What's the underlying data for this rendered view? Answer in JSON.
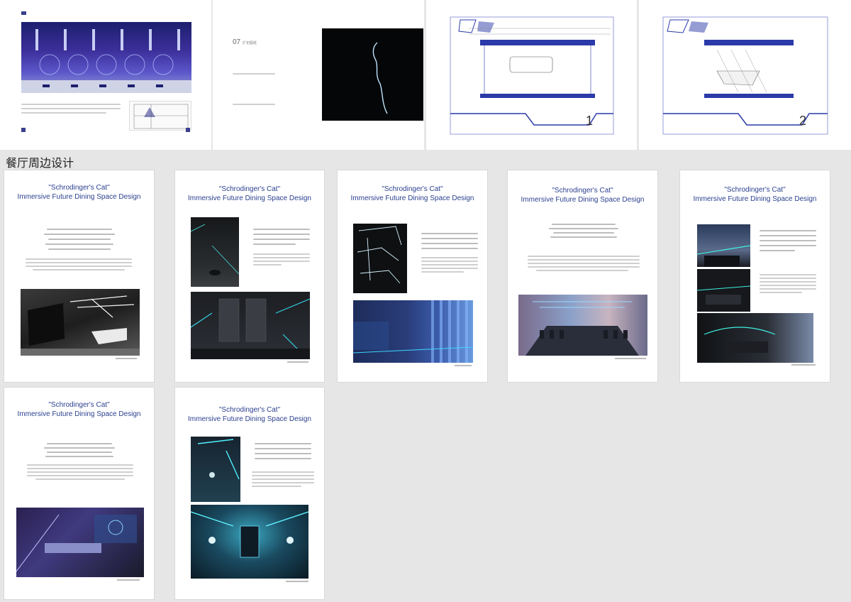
{
  "section_title": "餐厅周边设计",
  "top_pages": {
    "chapter_number": "07",
    "chapter_label": "扩初图纸",
    "plan_labels": [
      "1",
      "2"
    ]
  },
  "cards": [
    {
      "title1": "\"Schrodinger's Cat\"",
      "title2": "Immersive Future Dining Space Design"
    },
    {
      "title1": "\"Schrodinger's Cat\"",
      "title2": "Immersive Future Dining Space Design"
    },
    {
      "title1": "\"Schrodinger's Cat\"",
      "title2": "Immersive Future Dining Space Design"
    },
    {
      "title1": "\"Schrodinger's Cat\"",
      "title2": "Immersive Future Dining Space Design"
    },
    {
      "title1": "\"Schrodinger's Cat\"",
      "title2": "Immersive Future Dining Space Design"
    },
    {
      "title1": "\"Schrodinger's Cat\"",
      "title2": "Immersive Future Dining Space Design"
    },
    {
      "title1": "\"Schrodinger's Cat\"",
      "title2": "Immersive Future Dining Space Design"
    }
  ]
}
